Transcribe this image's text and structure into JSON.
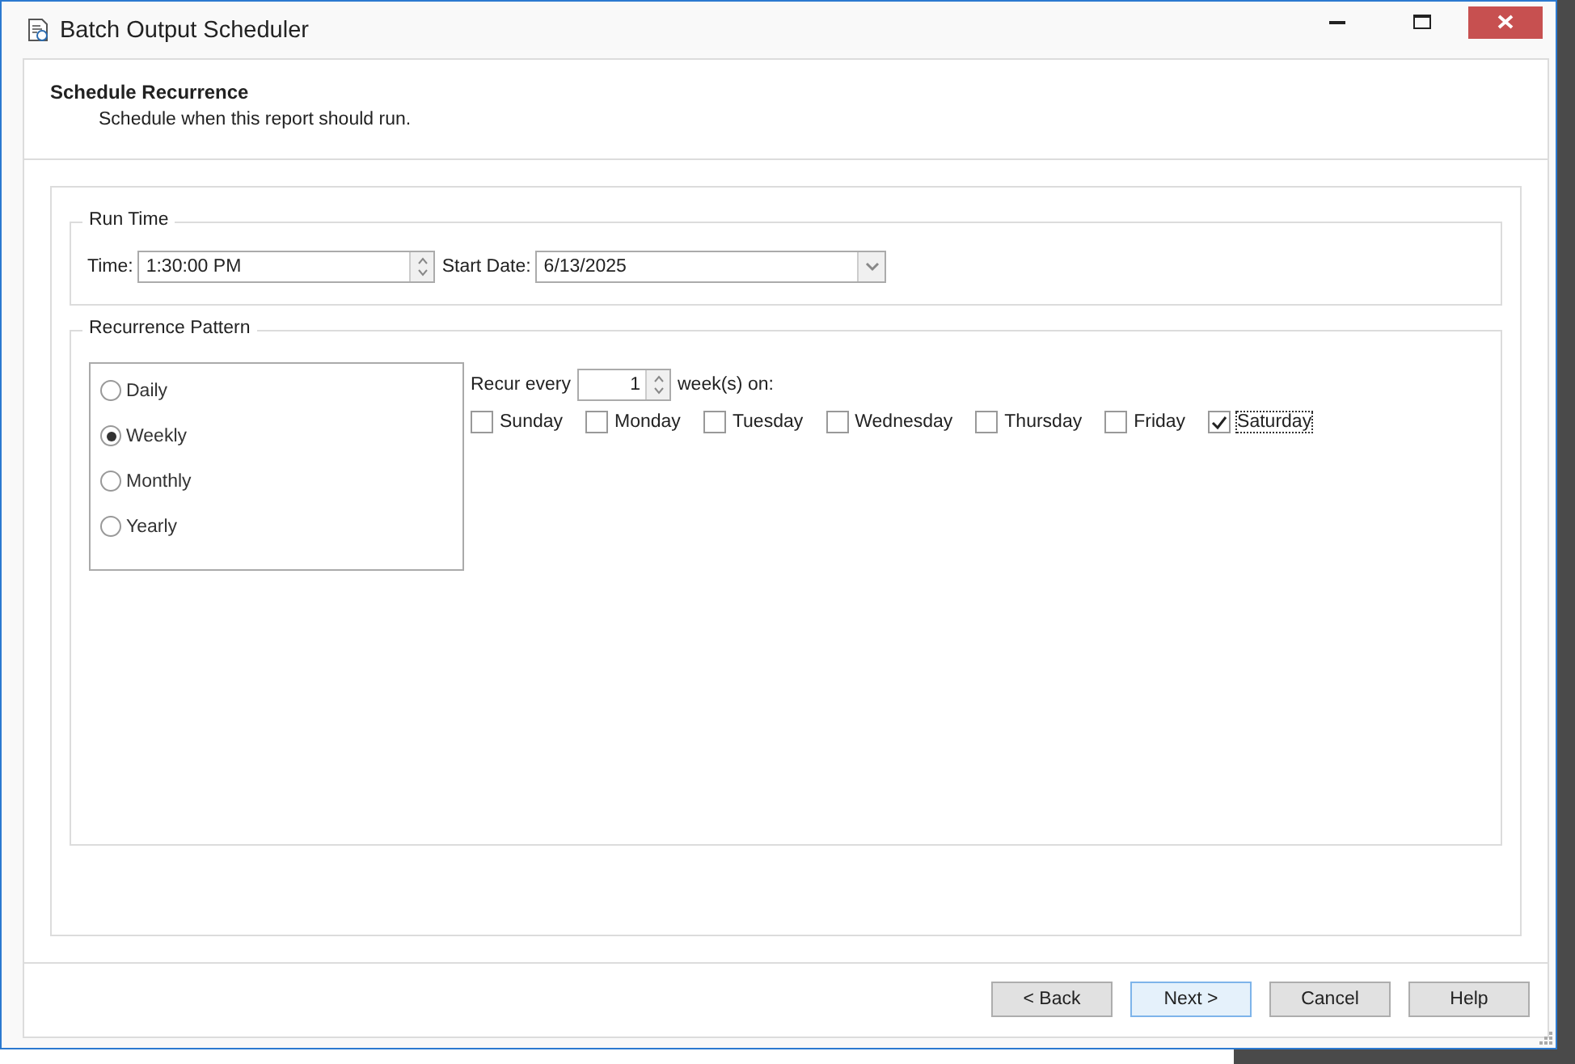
{
  "window": {
    "title": "Batch Output Scheduler"
  },
  "header": {
    "title": "Schedule Recurrence",
    "subtitle": "Schedule when this report should run."
  },
  "run_time": {
    "legend": "Run Time",
    "time_label": "Time:",
    "time_value": "1:30:00 PM",
    "start_date_label": "Start Date:",
    "start_date_value": "6/13/2025"
  },
  "recurrence": {
    "legend": "Recurrence Pattern",
    "patterns": [
      {
        "label": "Daily",
        "selected": false
      },
      {
        "label": "Weekly",
        "selected": true
      },
      {
        "label": "Monthly",
        "selected": false
      },
      {
        "label": "Yearly",
        "selected": false
      }
    ],
    "recur_label": "Recur every",
    "recur_value": "1",
    "recur_suffix": "week(s) on:",
    "days": [
      {
        "label": "Sunday",
        "checked": false
      },
      {
        "label": "Monday",
        "checked": false
      },
      {
        "label": "Tuesday",
        "checked": false
      },
      {
        "label": "Wednesday",
        "checked": false
      },
      {
        "label": "Thursday",
        "checked": false
      },
      {
        "label": "Friday",
        "checked": false
      },
      {
        "label": "Saturday",
        "checked": true
      }
    ]
  },
  "buttons": [
    {
      "label": "< Back",
      "kind": "normal"
    },
    {
      "label": "Next >",
      "kind": "default"
    },
    {
      "label": "Cancel",
      "kind": "normal"
    },
    {
      "label": "Help",
      "kind": "normal"
    }
  ]
}
